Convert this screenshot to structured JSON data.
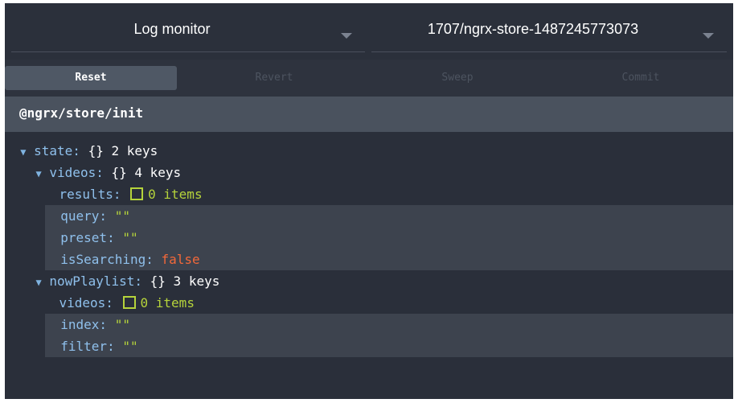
{
  "header": {
    "monitor_label": "Log monitor",
    "instance_label": "1707/ngrx-store-1487245773073"
  },
  "actions": {
    "reset": "Reset",
    "revert": "Revert",
    "sweep": "Sweep",
    "commit": "Commit"
  },
  "action_item": "@ngrx/store/init",
  "tree": {
    "state_key": "state:",
    "state_meta": "2 keys",
    "videos_key": "videos:",
    "videos_meta": "4 keys",
    "results_key": "results:",
    "results_meta": "0 items",
    "query_key": "query:",
    "query_val": "\"\"",
    "preset_key": "preset:",
    "preset_val": "\"\"",
    "isSearching_key": "isSearching:",
    "isSearching_val": "false",
    "nowPlaylist_key": "nowPlaylist:",
    "nowPlaylist_meta": "3 keys",
    "np_videos_key": "videos:",
    "np_videos_meta": "0 items",
    "index_key": "index:",
    "index_val": "\"\"",
    "filter_key": "filter:",
    "filter_val": "\"\"",
    "object_brace": "{}"
  },
  "colors": {
    "background": "#2a2f3a",
    "key": "#8fc0ec",
    "string": "#b5d33b",
    "boolean": "#f2683a"
  },
  "icons": {
    "expand": "triangle-down-icon",
    "array": "array-box-icon",
    "dropdown": "chevron-down-icon"
  }
}
